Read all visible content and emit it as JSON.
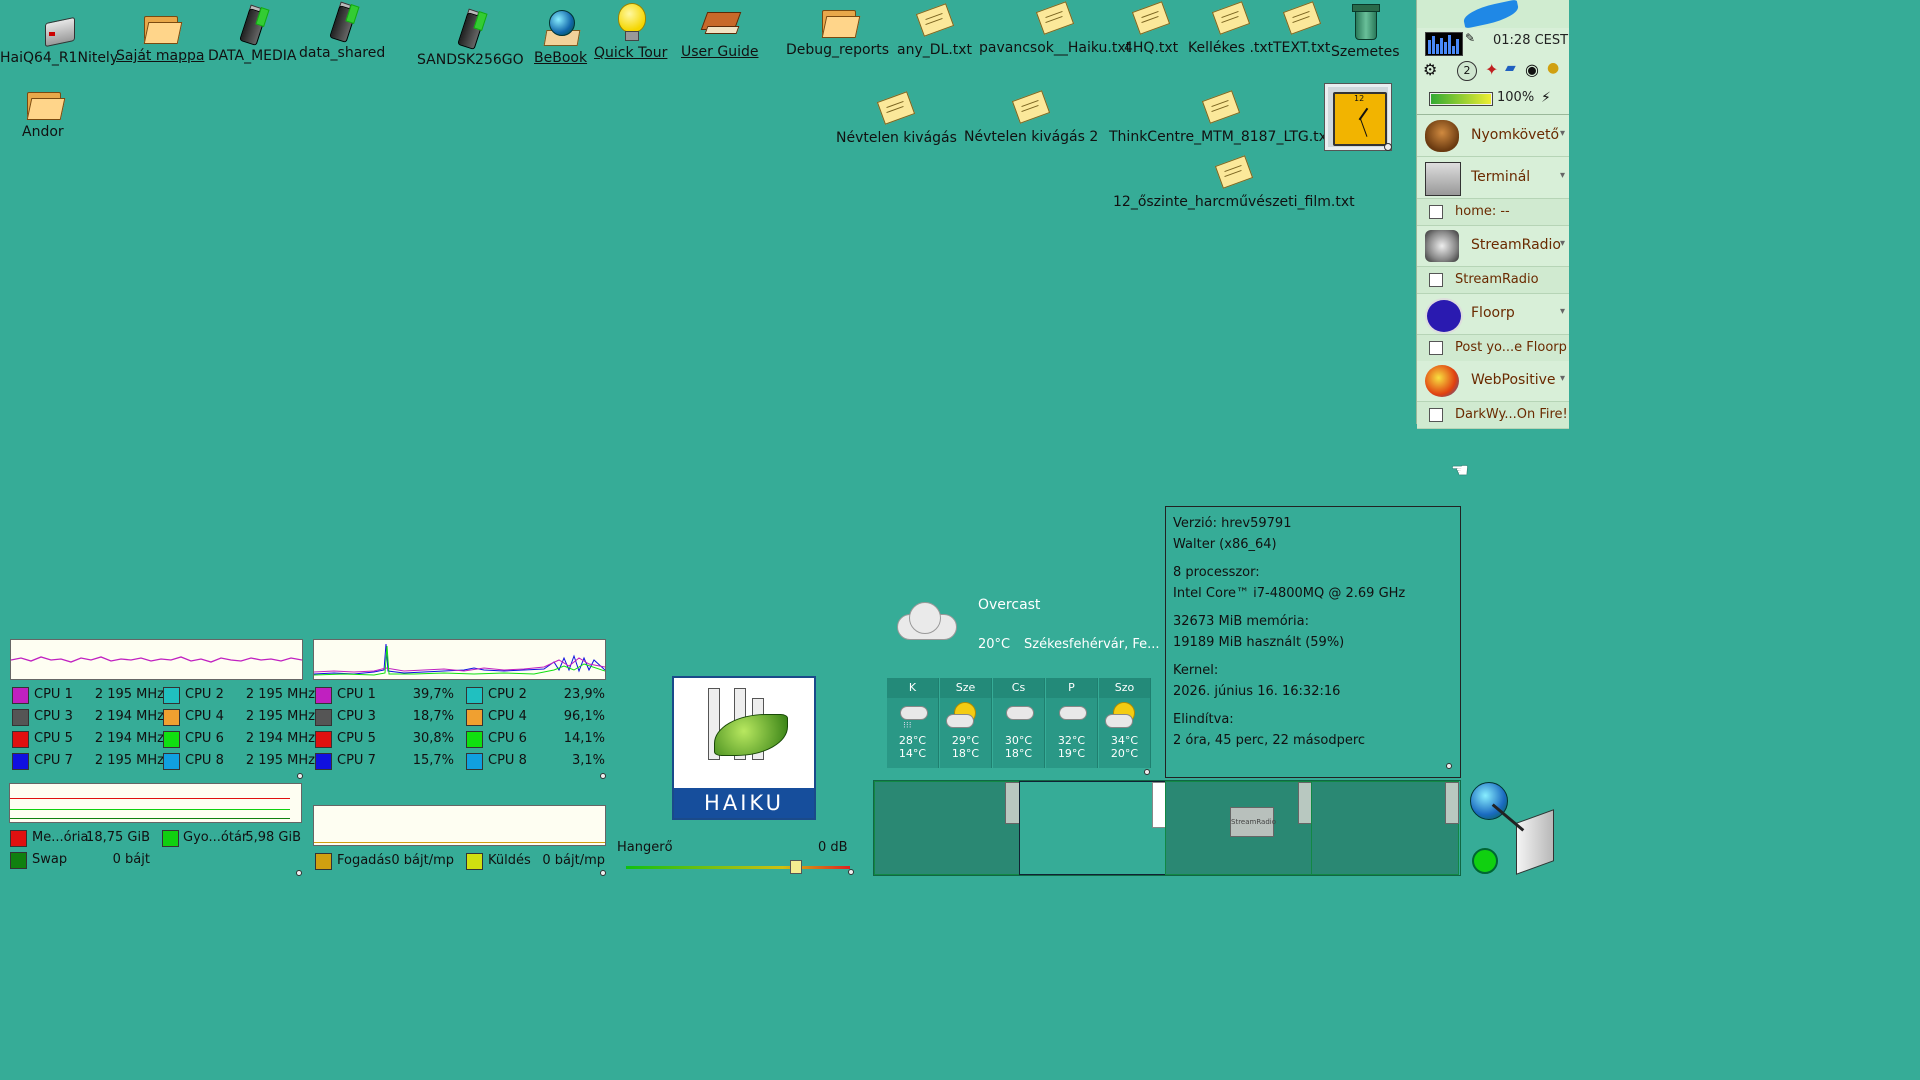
{
  "desktop_icons": {
    "haiq64": "HaiQ64_R1Nitely",
    "sajat": "Saját mappa",
    "data_media": "DATA_MEDIA",
    "data_shared": "data_shared",
    "sandsk": "SANDSK256GO",
    "bebook": "BeBook",
    "quicktour": "Quick Tour",
    "userguide": "User Guide",
    "debug": "Debug_reports",
    "anydl": "any_DL.txt",
    "pavancsok": "pavancsok__Haiku.txt",
    "hq4": "4HQ.txt",
    "kellekes": "Kellékes .txt",
    "text": "TEXT.txt",
    "szemetes": "Szemetes",
    "andor": "Andor",
    "nevtelen1": "Névtelen kivágás",
    "nevtelen2": "Névtelen kivágás 2",
    "thinkcentre": "ThinkCentre_MTM_8187_LTG.txt",
    "film": "12_őszinte_harcművészeti_film.txt"
  },
  "deskbar": {
    "time": "01:28 CEST",
    "workspace": "2",
    "battery": "100%",
    "battery_level": 1.0,
    "apps": [
      {
        "name": "Nyomkövető"
      },
      {
        "name": "Terminál",
        "window": "home: --"
      },
      {
        "name": "StreamRadio",
        "window": "StreamRadio"
      },
      {
        "name": "Floorp",
        "window": "Post yo...e Floorp"
      },
      {
        "name": "WebPositive",
        "window": "DarkWy...On Fire!"
      }
    ]
  },
  "cpu_speed": [
    {
      "name": "CPU 1",
      "value": "2 195 MHz",
      "color": "#c020c0"
    },
    {
      "name": "CPU 2",
      "value": "2 195 MHz",
      "color": "#20c0c0"
    },
    {
      "name": "CPU 3",
      "value": "2 194 MHz",
      "color": "#555555"
    },
    {
      "name": "CPU 4",
      "value": "2 195 MHz",
      "color": "#f0a030"
    },
    {
      "name": "CPU 5",
      "value": "2 194 MHz",
      "color": "#e01010"
    },
    {
      "name": "CPU 6",
      "value": "2 194 MHz",
      "color": "#10e010"
    },
    {
      "name": "CPU 7",
      "value": "2 195 MHz",
      "color": "#1010e0"
    },
    {
      "name": "CPU 8",
      "value": "2 195 MHz",
      "color": "#10a0e0"
    }
  ],
  "cpu_usage": [
    {
      "name": "CPU 1",
      "value": "39,7%",
      "color": "#c020c0"
    },
    {
      "name": "CPU 2",
      "value": "23,9%",
      "color": "#20c0c0"
    },
    {
      "name": "CPU 3",
      "value": "18,7%",
      "color": "#555555"
    },
    {
      "name": "CPU 4",
      "value": "96,1%",
      "color": "#f0a030"
    },
    {
      "name": "CPU 5",
      "value": "30,8%",
      "color": "#e01010"
    },
    {
      "name": "CPU 6",
      "value": "14,1%",
      "color": "#10e010"
    },
    {
      "name": "CPU 7",
      "value": "15,7%",
      "color": "#1010e0"
    },
    {
      "name": "CPU 8",
      "value": "3,1%",
      "color": "#10a0e0"
    }
  ],
  "memory": {
    "mem_label": "Me...ória",
    "mem_value": "18,75 GiB",
    "mem_color": "#e01010",
    "cache_label": "Gyo...ótár",
    "cache_value": "5,98 GiB",
    "cache_color": "#10d010",
    "swap_label": "Swap",
    "swap_value": "0 bájt",
    "swap_color": "#108010"
  },
  "network": {
    "recv_label": "Fogadás",
    "recv_value": "0 bájt/mp",
    "recv_color": "#d0a010",
    "send_label": "Küldés",
    "send_value": "0 bájt/mp",
    "send_color": "#d0e010"
  },
  "volume": {
    "label": "Hangerő",
    "value": "0 dB"
  },
  "haiku_logo_text": "HAIKU",
  "weather": {
    "condition": "Overcast",
    "temp": "20°C",
    "location": "Székesfehérvár, Fe...",
    "forecast": [
      {
        "day": "K",
        "hi": "28°C",
        "lo": "14°C",
        "icon": "rain-cloud-icon"
      },
      {
        "day": "Sze",
        "hi": "29°C",
        "lo": "18°C",
        "icon": "sun-cloud-icon"
      },
      {
        "day": "Cs",
        "hi": "30°C",
        "lo": "18°C",
        "icon": "cloud-icon"
      },
      {
        "day": "P",
        "hi": "32°C",
        "lo": "19°C",
        "icon": "cloud-icon"
      },
      {
        "day": "Szo",
        "hi": "34°C",
        "lo": "20°C",
        "icon": "sun-cloud-icon"
      }
    ]
  },
  "sysinfo": {
    "version": "Verzió: hrev59791",
    "arch": "Walter (x86_64)",
    "cpus": "8 processzor:",
    "cpu_model": "Intel Core™ i7-4800MQ @ 2.69 GHz",
    "mem_total": "32673 MiB memória:",
    "mem_used": "19189 MiB használt (59%)",
    "kernel_label": "Kernel:",
    "kernel_date": "2026. június 16. 16:32:16",
    "uptime_label": "Elindítva:",
    "uptime": "2 óra, 45 perc, 22 másodperc"
  },
  "workspaces": {
    "ws3_window": "StreamRadio"
  }
}
